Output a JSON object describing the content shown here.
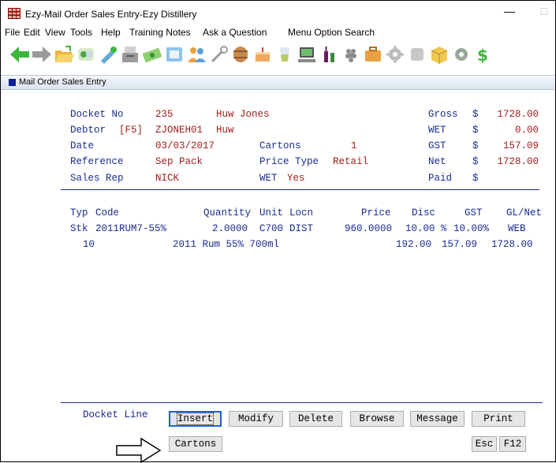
{
  "window": {
    "title": "Ezy-Mail Order Sales Entry-Ezy Distillery",
    "minimize": "—",
    "maximize": "□"
  },
  "menu": [
    "File",
    "Edit",
    "View",
    "Tools",
    "Help",
    "Training Notes",
    "Ask a Question",
    "Menu Option Search"
  ],
  "toolbar_icons": [
    "back-arrow-icon",
    "forward-arrow-icon",
    "open-folder-icon",
    "pills-icon",
    "brush-icon",
    "register-icon",
    "money-icon",
    "scanner-icon",
    "users-icon",
    "wrench-icon",
    "barrel-icon",
    "cake-icon",
    "glass-icon",
    "computer-icon",
    "bottles-icon",
    "grapes-icon",
    "briefcase-icon",
    "gear-icon",
    "square-icon",
    "box-icon",
    "gear-green-icon",
    "dollar-icon"
  ],
  "doc_tab": {
    "label": "Mail Order Sales Entry"
  },
  "header": {
    "docket_label": "Docket No",
    "docket_no": "235",
    "customer_name": "Huw Jones",
    "debtor_label": "Debtor",
    "debtor_key": "[F5]",
    "debtor_code": "ZJONEH01",
    "debtor_short": "Huw",
    "date_label": "Date",
    "date": "03/03/2017",
    "cartons_label": "Cartons",
    "cartons": "1",
    "reference_label": "Reference",
    "reference": "Sep Pack",
    "price_type_label": "Price Type",
    "price_type": "Retail",
    "sales_rep_label": "Sales Rep",
    "sales_rep": "NICK",
    "wet_label": "WET",
    "wet_value": "Yes"
  },
  "totals": {
    "gross_label": "Gross",
    "gross": "1728.00",
    "wet_label": "WET",
    "wet": "0.00",
    "gst_label": "GST",
    "gst": "157.09",
    "net_label": "Net",
    "net": "1728.00",
    "paid_label": "Paid",
    "paid": "",
    "currency": "$"
  },
  "lines": {
    "columns": {
      "typ": "Typ",
      "code": "Code",
      "quantity": "Quantity",
      "unit": "Unit",
      "locn": "Locn",
      "price": "Price",
      "disc": "Disc",
      "gst": "GST",
      "glnet": "GL/Net"
    },
    "rows": [
      {
        "typ": "Stk",
        "code": "2011RUM7-55%",
        "quantity": "2.0000",
        "unit": "C700",
        "locn": "DIST",
        "price": "960.0000",
        "disc": "10.00 %",
        "gst_rate": "10.00%",
        "gl": "WEB",
        "line_no": "10",
        "description": "2011 Rum 55% 700ml",
        "disc_amount": "192.00",
        "gst_amount": "157.09",
        "net": "1728.00"
      }
    ]
  },
  "footer": {
    "section_label": "Docket Line",
    "buttons": {
      "insert": "Insert",
      "modify": "Modify",
      "delete": "Delete",
      "browse": "Browse",
      "message": "Message",
      "print": "Print",
      "cartons": "Cartons",
      "esc": "Esc",
      "f12": "F12"
    }
  }
}
